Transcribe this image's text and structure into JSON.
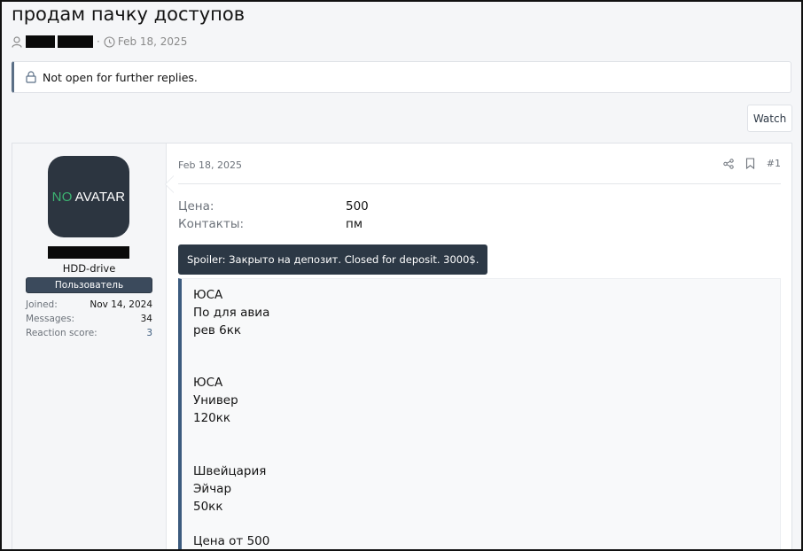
{
  "thread": {
    "title": "продам пачку доступов",
    "date": "Feb 18, 2025",
    "locked_notice": "Not open for further replies.",
    "watch_label": "Watch"
  },
  "user": {
    "avatar_no": "NO",
    "avatar_text": "AVATAR",
    "title": "HDD-drive",
    "badge": "Пользователь",
    "stats": [
      {
        "label": "Joined:",
        "value": "Nov 14, 2024"
      },
      {
        "label": "Messages:",
        "value": "34"
      },
      {
        "label": "Reaction score:",
        "value": "3"
      }
    ]
  },
  "post": {
    "date": "Feb 18, 2025",
    "number": "#1",
    "fields": [
      {
        "label": "Цена:",
        "value": "500"
      },
      {
        "label": "Контакты:",
        "value": "пм"
      }
    ],
    "spoiler_label": "Spoiler: Закрыто на депозит. Closed for deposit. 3000$.",
    "spoiler_lines": [
      "ЮСА",
      "По для авиа",
      "рев 6кк",
      "",
      "",
      "ЮСА",
      "Универ",
      "120кк",
      "",
      "",
      "Швейцария",
      "Эйчар",
      "50кк",
      "",
      "Цена от 500"
    ]
  },
  "colors": {
    "accent": "#3c5b7e",
    "badge_bg": "#3b4a5c",
    "avatar_bg": "#2c3540",
    "avatar_no": "#3cb371"
  }
}
